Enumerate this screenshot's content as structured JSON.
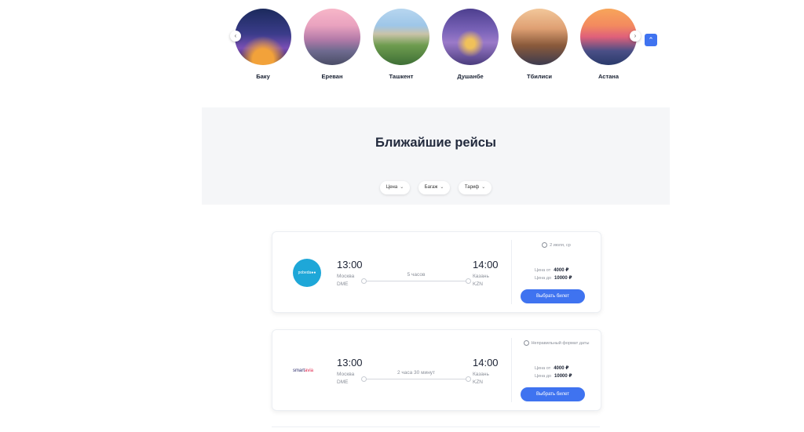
{
  "destinations": [
    {
      "name": "Баку",
      "palette": [
        "#1b2a5c",
        "#7a4fb5",
        "#f2a23a"
      ]
    },
    {
      "name": "Ереван",
      "palette": [
        "#f7b6c8",
        "#b27aa8",
        "#5a5d7a"
      ]
    },
    {
      "name": "Ташкент",
      "palette": [
        "#9ec6e8",
        "#6e9c4f",
        "#3e6f36"
      ]
    },
    {
      "name": "Душанбе",
      "palette": [
        "#4d3f8f",
        "#9b7ac9",
        "#f0c15a"
      ]
    },
    {
      "name": "Тбилиси",
      "palette": [
        "#dfa073",
        "#8a5a3b",
        "#3c3b4e"
      ]
    },
    {
      "name": "Астана",
      "palette": [
        "#f7a55a",
        "#e0607a",
        "#2a3a6b"
      ]
    }
  ],
  "carousel": {
    "prev": "‹",
    "next": "›"
  },
  "scroll_top": "⌃",
  "section": {
    "title": "Ближайшие рейсы",
    "filters": [
      "Цена",
      "Багаж",
      "Тариф"
    ],
    "filter_chevron": "⌄"
  },
  "flights": [
    {
      "airline": "pobeda",
      "logo_text": "pobeda●●",
      "dep_time": "13:00",
      "dep_city": "Москва",
      "dep_code": "DME",
      "arr_time": "14:00",
      "arr_city": "Казань",
      "arr_code": "KZN",
      "duration": "5 часов",
      "date": "2 июля, ср",
      "price_from_label": "Цена от",
      "price_from": "4000 ₽",
      "price_to_label": "Цена до",
      "price_to": "10000 ₽",
      "button": "Выбрать билет"
    },
    {
      "airline": "smartavia",
      "logo_text_a": "smart",
      "logo_text_b": "avia",
      "dep_time": "13:00",
      "dep_city": "Москва",
      "dep_code": "DME",
      "arr_time": "14:00",
      "arr_city": "Казань",
      "arr_code": "KZN",
      "duration": "2 часа 30 минут",
      "date": "Неправильный формат даты",
      "price_from_label": "Цена от",
      "price_from": "4000 ₽",
      "price_to_label": "Цена до",
      "price_to": "10000 ₽",
      "button": "Выбрать билет"
    }
  ],
  "colors": {
    "accent": "#3f73f0",
    "hero_bg": "#f5f6f8",
    "pobeda": "#1ea7d8"
  }
}
